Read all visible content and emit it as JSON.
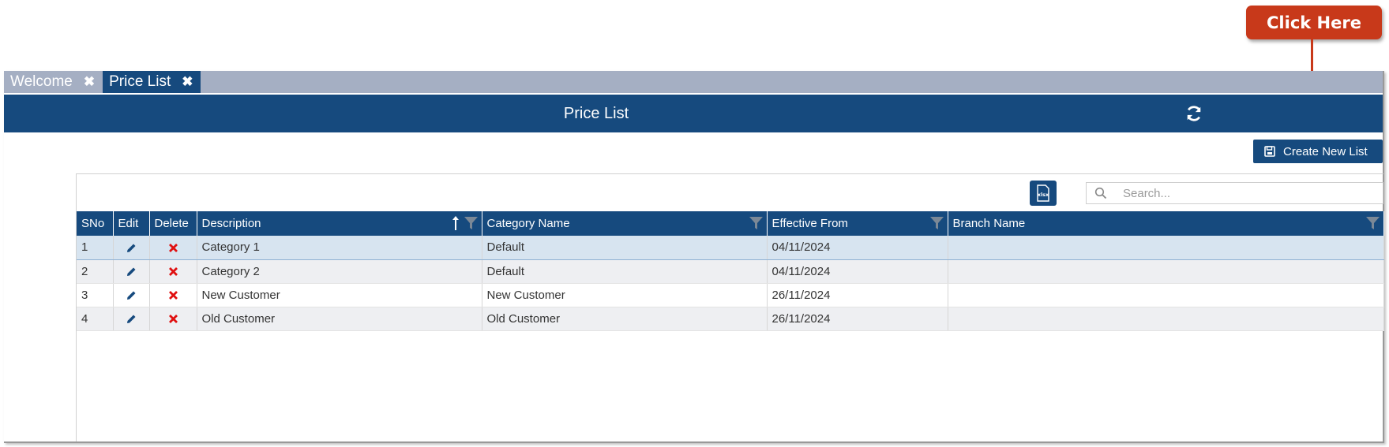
{
  "callout": {
    "label": "Click Here"
  },
  "tabs": [
    {
      "label": "Welcome",
      "close": "✖"
    },
    {
      "label": "Price List",
      "close": "✖"
    }
  ],
  "header": {
    "title": "Price List"
  },
  "toolbar": {
    "create_label": "Create New List",
    "export_label": "xlsx"
  },
  "search": {
    "placeholder": "Search..."
  },
  "table": {
    "columns": [
      "SNo",
      "Edit",
      "Delete",
      "Description",
      "Category Name",
      "Effective From",
      "Branch Name"
    ],
    "rows": [
      {
        "sno": "1",
        "description": "Category 1",
        "category": "Default",
        "effective": "04/11/2024",
        "branch": ""
      },
      {
        "sno": "2",
        "description": "Category 2",
        "category": "Default",
        "effective": "04/11/2024",
        "branch": ""
      },
      {
        "sno": "3",
        "description": "New Customer",
        "category": "New Customer",
        "effective": "26/11/2024",
        "branch": ""
      },
      {
        "sno": "4",
        "description": "Old Customer",
        "category": "Old Customer",
        "effective": "26/11/2024",
        "branch": ""
      }
    ]
  },
  "colors": {
    "primary": "#164a7e",
    "tabbar": "#a5afc3",
    "callout": "#c8391a",
    "delete": "#e01010",
    "selected_row": "#d7e4f0"
  }
}
